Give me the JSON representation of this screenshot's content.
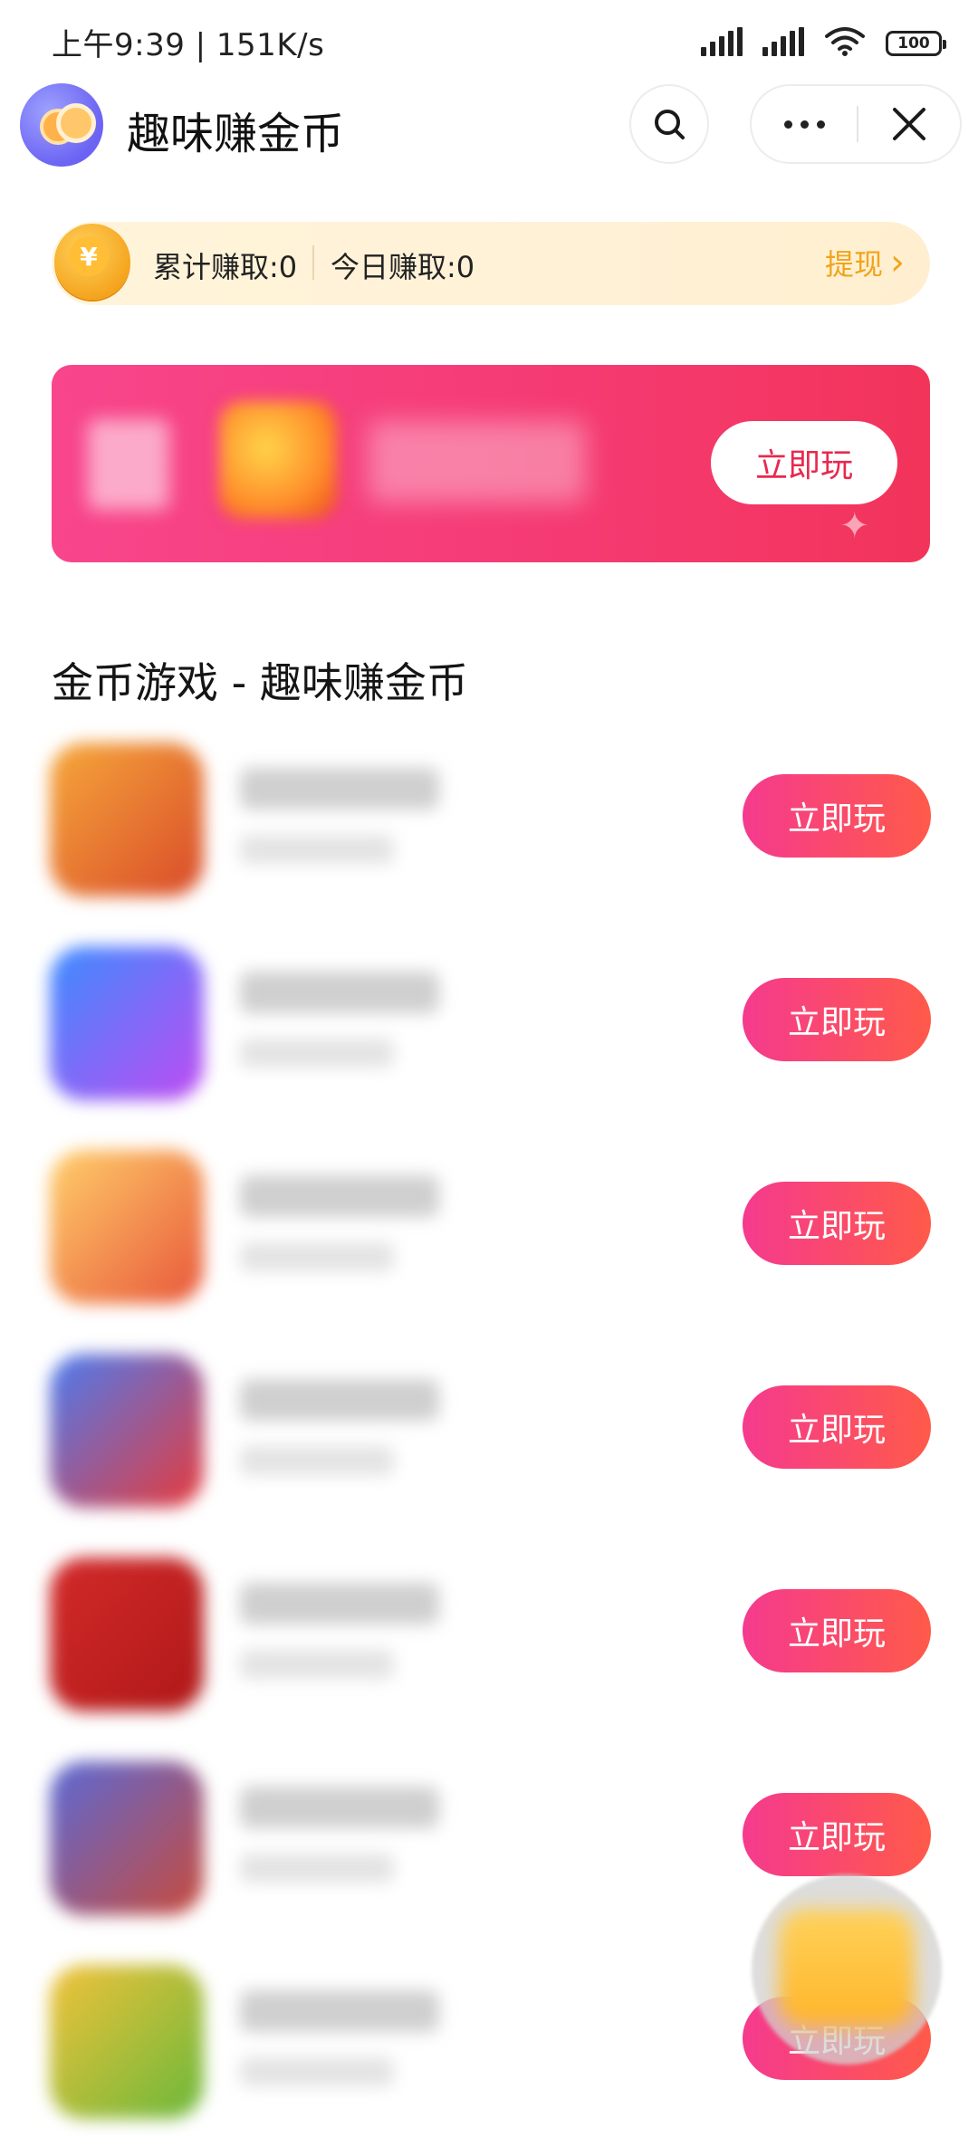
{
  "status_bar": {
    "time": "上午9:39 | 151K/s",
    "battery": "100"
  },
  "header": {
    "title": "趣味赚金币"
  },
  "earnings": {
    "coin_symbol": "¥",
    "total_label": "累计赚取:0",
    "today_label": "今日赚取:0",
    "withdraw_label": "提现",
    "withdraw_arrow": "›"
  },
  "banner": {
    "button_label": "立即玩"
  },
  "section": {
    "title": "金币游戏 - 趣味赚金币"
  },
  "games": [
    {
      "button_label": "立即玩",
      "icon_colors": [
        "#f6a83a",
        "#d94a2a"
      ]
    },
    {
      "button_label": "立即玩",
      "icon_colors": [
        "#3b8cff",
        "#c04bf2"
      ]
    },
    {
      "button_label": "立即玩",
      "icon_colors": [
        "#ffcf6a",
        "#e8563a"
      ]
    },
    {
      "button_label": "立即玩",
      "icon_colors": [
        "#4a7cf2",
        "#e83a3a"
      ]
    },
    {
      "button_label": "立即玩",
      "icon_colors": [
        "#d22a2a",
        "#b01818"
      ]
    },
    {
      "button_label": "立即玩",
      "icon_colors": [
        "#5a6ad8",
        "#c84a3a"
      ]
    },
    {
      "button_label": "立即玩",
      "icon_colors": [
        "#f2c23a",
        "#6ab83a"
      ]
    }
  ],
  "colors": {
    "accent": "#f53a72",
    "gold": "#f0a41b"
  }
}
